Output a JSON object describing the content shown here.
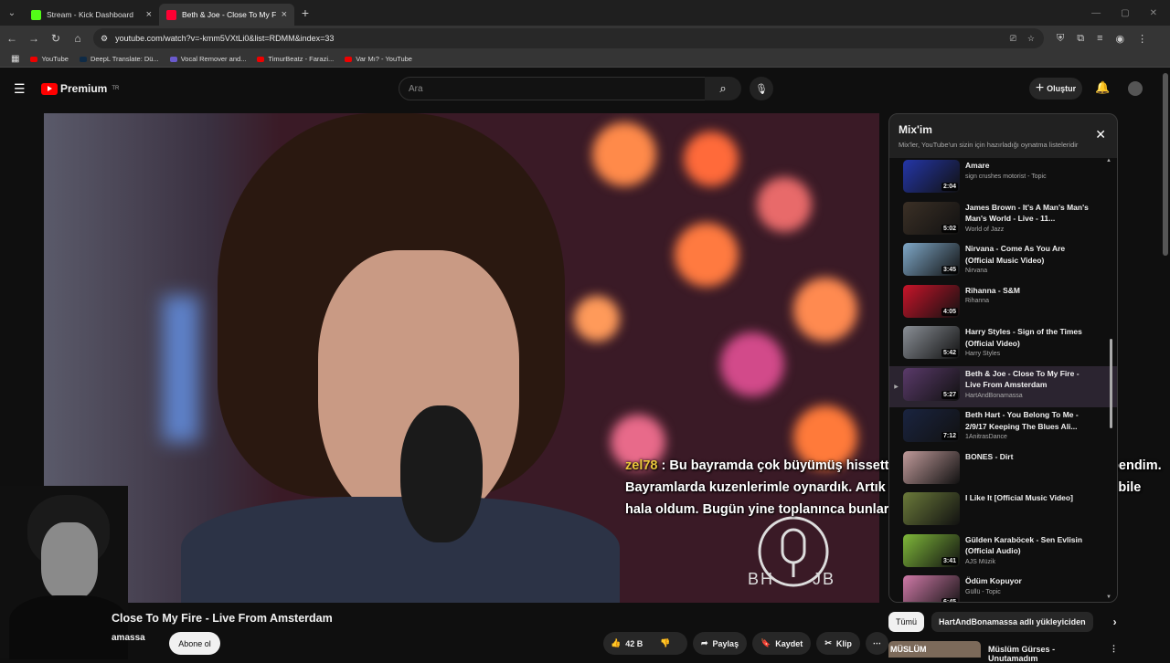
{
  "browser": {
    "tabs": [
      {
        "title": "Stream - Kick Dashboard",
        "favicon_color": "#53fc18",
        "active": false
      },
      {
        "title": "Beth & Joe - Close To My F",
        "favicon_color": "#ff0033",
        "active": true
      }
    ],
    "url": "youtube.com/watch?v=-kmm5VXtLi0&list=RDMM&index=33",
    "bookmarks": [
      {
        "label": "YouTube"
      },
      {
        "label": "DeepL Translate: Dü..."
      },
      {
        "label": "Vocal Remover and..."
      },
      {
        "label": "TimurBeatz - Farazi..."
      },
      {
        "label": "Var Mı? - YouTube"
      }
    ]
  },
  "header": {
    "logo_text": "Premium",
    "country": "TR",
    "search_placeholder": "Ara",
    "create_label": "Oluştur"
  },
  "chat_overlay": {
    "user": "zel78",
    "message": " : Bu bayramda çok büyümüş hissettim. Baba tarafında en küçük çocuk bendim. Bayramlarda kuzenlerimle oynardık. Artık evli olanlar, çocuğu olanlar var. Ben bile hala oldum. Bugün yine toplanınca bunları düşündüm bir tur :D"
  },
  "video": {
    "watermark": "BH      JB",
    "title": "Close To My Fire - Live From Amsterdam",
    "channel": "amassa",
    "subscribe_label": "Abone ol",
    "likes": "42 B",
    "share_label": "Paylaş",
    "save_label": "Kaydet",
    "clip_label": "Klip"
  },
  "playlist": {
    "title": "Mix'im",
    "subtitle": "Mix'ler, YouTube'un sizin için hazırladığı oynatma listeleridir",
    "items": [
      {
        "title": "Amare",
        "artist": "sign crushes motorist - Topic",
        "duration": "2:04",
        "thumb": "#2436a8"
      },
      {
        "title": "James Brown - It's A Man's Man's Man's World - Live - 11...",
        "artist": "World of Jazz",
        "duration": "5:02",
        "thumb": "#3b3026"
      },
      {
        "title": "Nirvana - Come As You Are (Official Music Video)",
        "artist": "Nirvana",
        "duration": "3:45",
        "thumb": "#7fa8c8"
      },
      {
        "title": "Rihanna - S&M",
        "artist": "Rihanna",
        "duration": "4:05",
        "thumb": "#c8142a"
      },
      {
        "title": "Harry Styles - Sign of the Times (Official Video)",
        "artist": "Harry Styles",
        "duration": "5:42",
        "thumb": "#8a8f96"
      },
      {
        "title": "Beth & Joe - Close To My Fire - Live From Amsterdam",
        "artist": "HartAndBonamassa",
        "duration": "5:27",
        "thumb": "#5a3a6a",
        "active": true
      },
      {
        "title": "Beth Hart - You Belong To Me - 2/9/17 Keeping The Blues Ali...",
        "artist": "1AnitrasDance",
        "duration": "7:12",
        "thumb": "#1a2440"
      },
      {
        "title": "BONES - Dirt",
        "artist": "",
        "duration": "",
        "thumb": "#c09a9a"
      },
      {
        "title": "I Like It [Official Music Video]",
        "artist": "",
        "duration": "",
        "thumb": "#6b7a3a"
      },
      {
        "title": "Gülden Karaböcek - Sen Evlisin (Official Audio)",
        "artist": "AJS Müzik",
        "duration": "3:41",
        "thumb": "#7fb83a"
      },
      {
        "title": "Ödüm Kopuyor",
        "artist": "Güllü - Topic",
        "duration": "6:45",
        "thumb": "#d07aa8"
      }
    ]
  },
  "chips": {
    "all": "Tümü",
    "uploader": "HartAndBonamassa adlı yükleyiciden"
  },
  "recommendation": {
    "thumb_text": "MÜSLÜM",
    "title": "Müslüm Gürses - Unutamadım"
  }
}
